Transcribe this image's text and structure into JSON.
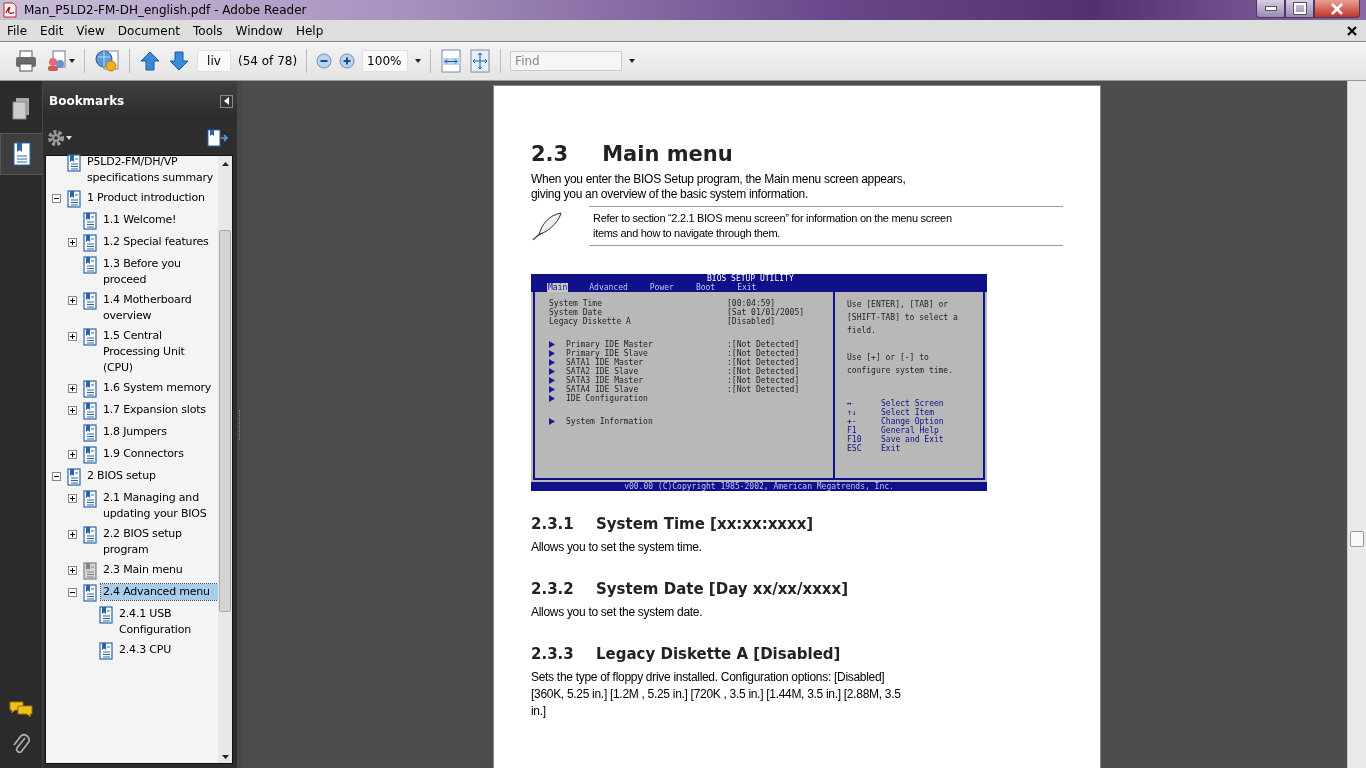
{
  "window": {
    "title": "Man_P5LD2-FM-DH_english.pdf - Adobe Reader"
  },
  "menu": [
    "File",
    "Edit",
    "View",
    "Document",
    "Tools",
    "Window",
    "Help"
  ],
  "toolbar": {
    "page_field": "liv",
    "page_count": "(54 of 78)",
    "zoom": "100%",
    "find_placeholder": "Find"
  },
  "sidebar": {
    "title": "Bookmarks",
    "tabs": [
      {
        "selected": false
      },
      {
        "selected": true
      }
    ],
    "items": [
      {
        "label": "P5LD2-FM/DH/VP specifications summary",
        "selected": false,
        "dimmed": false
      },
      {
        "label": "1  Product introduction",
        "expanded": true,
        "selected": false,
        "dimmed": false,
        "children": [
          {
            "label": "1.1 Welcome!",
            "selected": false,
            "dimmed": false
          },
          {
            "label": "1.2 Special features",
            "expanded": false,
            "selected": false,
            "dimmed": false
          },
          {
            "label": "1.3 Before you proceed",
            "selected": false,
            "dimmed": false
          },
          {
            "label": "1.4 Motherboard overview",
            "expanded": false,
            "selected": false,
            "dimmed": false
          },
          {
            "label": "1.5 Central Processing Unit (CPU)",
            "expanded": false,
            "selected": false,
            "dimmed": false
          },
          {
            "label": "1.6 System memory",
            "expanded": false,
            "selected": false,
            "dimmed": false
          },
          {
            "label": "1.7 Expansion slots",
            "expanded": false,
            "selected": false,
            "dimmed": false
          },
          {
            "label": "1.8 Jumpers",
            "selected": false,
            "dimmed": false
          },
          {
            "label": "1.9 Connectors",
            "expanded": false,
            "selected": false,
            "dimmed": false
          }
        ]
      },
      {
        "label": "2 BIOS setup",
        "expanded": true,
        "selected": false,
        "dimmed": false,
        "children": [
          {
            "label": "2.1 Managing and updating your BIOS",
            "expanded": false,
            "selected": false,
            "dimmed": false
          },
          {
            "label": "2.2 BIOS setup program",
            "expanded": false,
            "selected": false,
            "dimmed": false
          },
          {
            "label": "2.3 Main menu",
            "expanded": false,
            "selected": false,
            "dimmed": true
          },
          {
            "label": "2.4 Advanced menu",
            "expanded": true,
            "selected": true,
            "dimmed": false,
            "children": [
              {
                "label": "2.4.1 USB Configuration",
                "selected": false,
                "dimmed": false
              },
              {
                "label": "2.4.3 CPU",
                "selected": false,
                "dimmed": false
              }
            ]
          }
        ]
      }
    ]
  },
  "document": {
    "heading_number": "2.3",
    "heading": "Main menu",
    "intro": "When you enter the BIOS Setup program, the Main menu screen appears, giving you an overview of the basic system information.",
    "note": "Refer to section “2.2.1  BIOS menu screen” for information on the menu screen items and how to navigate through them.",
    "bios": {
      "title": "BIOS SETUP UTILITY",
      "tabs": [
        {
          "label": "Main",
          "selected": true
        },
        {
          "label": "Advanced",
          "selected": false
        },
        {
          "label": "Power",
          "selected": false
        },
        {
          "label": "Boot",
          "selected": false
        },
        {
          "label": "Exit",
          "selected": false
        }
      ],
      "rows": [
        {
          "kind": "field",
          "label": "System Time",
          "value": "[00:04:59]"
        },
        {
          "kind": "field",
          "label": "System Date",
          "value": "[Sat 01/01/2005]"
        },
        {
          "kind": "field",
          "label": "Legacy Diskette A",
          "value": "[Disabled]"
        },
        {
          "kind": "gap"
        },
        {
          "kind": "submenu",
          "label": "Primary IDE Master",
          "value": ":[Not Detected]"
        },
        {
          "kind": "submenu",
          "label": "Primary IDE Slave",
          "value": ":[Not Detected]"
        },
        {
          "kind": "submenu",
          "label": "SATA1 IDE Master",
          "value": ":[Not Detected]"
        },
        {
          "kind": "submenu",
          "label": "SATA2 IDE Slave",
          "value": ":[Not Detected]"
        },
        {
          "kind": "submenu",
          "label": "SATA3 IDE Master",
          "value": ":[Not Detected]"
        },
        {
          "kind": "submenu",
          "label": "SATA4 IDE Slave",
          "value": ":[Not Detected]"
        },
        {
          "kind": "submenu",
          "label": "IDE Configuration"
        },
        {
          "kind": "gap"
        },
        {
          "kind": "submenu",
          "label": "System Information"
        }
      ],
      "help": [
        "Use [ENTER], [TAB] or [SHIFT-TAB] to select a field.",
        "Use [+] or [-] to configure system time."
      ],
      "keys": [
        {
          "key": "↔",
          "action": "Select Screen"
        },
        {
          "key": "↑↓",
          "action": "Select Item"
        },
        {
          "key": "+-",
          "action": "Change Option"
        },
        {
          "key": "F1",
          "action": "General Help"
        },
        {
          "key": "F10",
          "action": "Save and Exit"
        },
        {
          "key": "ESC",
          "action": "Exit"
        }
      ],
      "footer": "v00.00 (C)Copyright 1985-2002, American Megatrends, Inc."
    },
    "sections": [
      {
        "number": "2.3.1",
        "title": "System Time [xx:xx:xxxx]",
        "text": "Allows you to set the system time."
      },
      {
        "number": "2.3.2",
        "title": "System Date [Day xx/xx/xxxx]",
        "text": "Allows you to set the system date."
      },
      {
        "number": "2.3.3",
        "title": "Legacy Diskette A [Disabled]",
        "text": "Sets the type of floppy drive installed. Configuration options: [Disabled] [360K, 5.25 in.] [1.2M , 5.25 in.] [720K , 3.5 in.] [1.44M, 3.5 in.] [2.88M, 3.5 in.]"
      }
    ]
  }
}
